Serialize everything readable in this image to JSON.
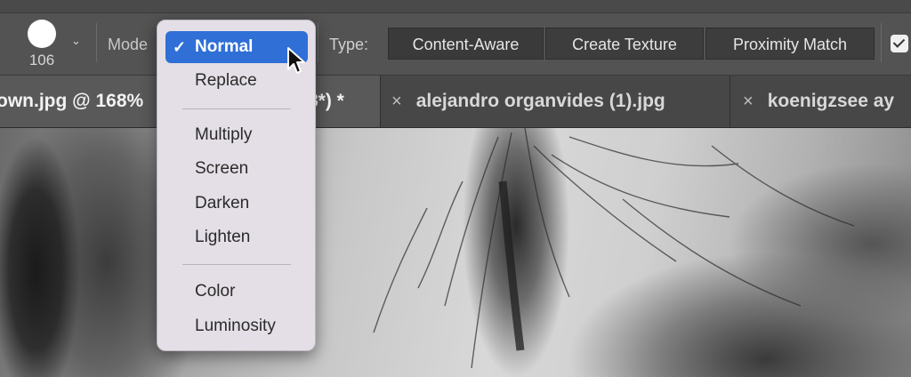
{
  "options_bar": {
    "brush_size": "106",
    "mode_label": "Mode",
    "type_label": "Type:",
    "type_buttons": [
      "Content-Aware",
      "Create Texture",
      "Proximity Match"
    ],
    "selected_type": "Content-Aware",
    "sample_all_layers_checked": true
  },
  "tabs": {
    "active_title": "own.jpg @ 168%",
    "active_title_tail": "8*) *",
    "inactive": [
      "alejandro organvides (1).jpg",
      "koenigzsee ay"
    ],
    "close_glyph": "×"
  },
  "mode_menu": {
    "selected": "Normal",
    "groups": [
      [
        "Normal",
        "Replace"
      ],
      [
        "Multiply",
        "Screen",
        "Darken",
        "Lighten"
      ],
      [
        "Color",
        "Luminosity"
      ]
    ],
    "check_glyph": "✓"
  },
  "icons": {
    "brush_preview": "brush-tip-icon",
    "brush_dropdown": "chevron-down-icon",
    "checkbox": "checkbox-checked-icon",
    "cursor": "arrow-cursor-icon"
  },
  "colors": {
    "menu_highlight": "#2f6fd6",
    "options_bar_bg": "#535353",
    "menu_bg": "#e4dfe6"
  }
}
